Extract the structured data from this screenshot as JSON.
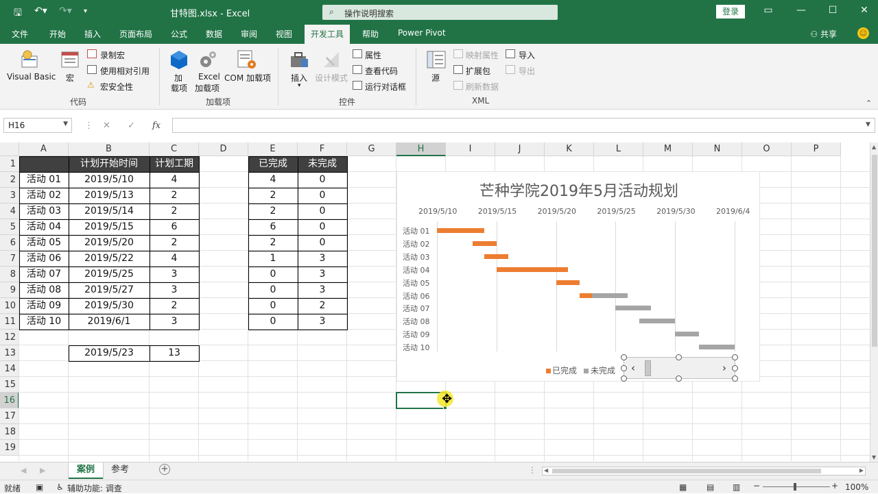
{
  "window": {
    "title": "甘特图.xlsx  -  Excel",
    "search_placeholder": "操作说明搜索",
    "login": "登录"
  },
  "tabs": [
    "文件",
    "开始",
    "插入",
    "页面布局",
    "公式",
    "数据",
    "审阅",
    "视图",
    "开发工具",
    "帮助",
    "Power Pivot"
  ],
  "active_tab": "开发工具",
  "share": "共享",
  "ribbon": {
    "code": {
      "group": "代码",
      "visual_basic": "Visual Basic",
      "macro": "宏",
      "record_macro": "录制宏",
      "relative_ref": "使用相对引用",
      "macro_security": "宏安全性"
    },
    "addins": {
      "group": "加载项",
      "addin_1": "加",
      "addin_2": "载项",
      "excel_addin_1": "Excel",
      "excel_addin_2": "加载项",
      "com_addin": "COM 加载项"
    },
    "controls": {
      "group": "控件",
      "insert": "插入",
      "design_mode": "设计模式",
      "properties": "属性",
      "view_code": "查看代码",
      "run_dialog": "运行对话框"
    },
    "xml": {
      "group": "XML",
      "source": "源",
      "map_properties": "映射属性",
      "expansion_packs": "扩展包",
      "refresh_data": "刷新数据",
      "import": "导入",
      "export": "导出"
    }
  },
  "formula_bar": {
    "name_box": "H16",
    "fx": "fx",
    "formula": ""
  },
  "columns": [
    "A",
    "B",
    "C",
    "D",
    "E",
    "F",
    "G",
    "H",
    "I",
    "J",
    "K",
    "L",
    "M",
    "N",
    "O",
    "P"
  ],
  "rows": [
    "1",
    "2",
    "3",
    "4",
    "5",
    "6",
    "7",
    "8",
    "9",
    "10",
    "11",
    "12",
    "13",
    "14",
    "15",
    "16",
    "17",
    "18",
    "19"
  ],
  "table1": {
    "headers": [
      "",
      "计划开始时间",
      "计划工期"
    ],
    "rows": [
      [
        "活动 01",
        "2019/5/10",
        "4"
      ],
      [
        "活动 02",
        "2019/5/13",
        "2"
      ],
      [
        "活动 03",
        "2019/5/14",
        "2"
      ],
      [
        "活动 04",
        "2019/5/15",
        "6"
      ],
      [
        "活动 05",
        "2019/5/20",
        "2"
      ],
      [
        "活动 06",
        "2019/5/22",
        "4"
      ],
      [
        "活动 07",
        "2019/5/25",
        "3"
      ],
      [
        "活动 08",
        "2019/5/27",
        "3"
      ],
      [
        "活动 09",
        "2019/5/30",
        "2"
      ],
      [
        "活动 10",
        "2019/6/1",
        "3"
      ]
    ]
  },
  "table2": {
    "headers": [
      "已完成",
      "未完成"
    ],
    "rows": [
      [
        "4",
        "0"
      ],
      [
        "2",
        "0"
      ],
      [
        "2",
        "0"
      ],
      [
        "6",
        "0"
      ],
      [
        "2",
        "0"
      ],
      [
        "1",
        "3"
      ],
      [
        "0",
        "3"
      ],
      [
        "0",
        "3"
      ],
      [
        "0",
        "2"
      ],
      [
        "0",
        "3"
      ]
    ]
  },
  "current_date": {
    "date": "2019/5/23",
    "value": "13"
  },
  "chart_data": {
    "type": "bar",
    "title": "芒种学院2019年5月活动规划",
    "x_tick_labels": [
      "2019/5/10",
      "2019/5/15",
      "2019/5/20",
      "2019/5/25",
      "2019/5/30",
      "2019/6/4"
    ],
    "xlim": [
      "2019/5/10",
      "2019/6/4"
    ],
    "categories": [
      "活动 01",
      "活动 02",
      "活动 03",
      "活动 04",
      "活动 05",
      "活动 06",
      "活动 07",
      "活动 08",
      "活动 09",
      "活动 10"
    ],
    "start": [
      "2019/5/10",
      "2019/5/13",
      "2019/5/14",
      "2019/5/15",
      "2019/5/20",
      "2019/5/22",
      "2019/5/25",
      "2019/5/27",
      "2019/5/30",
      "2019/6/1"
    ],
    "series": [
      {
        "name": "已完成",
        "values": [
          4,
          2,
          2,
          6,
          2,
          1,
          0,
          0,
          0,
          0
        ],
        "color": "#ed7d31"
      },
      {
        "name": "未完成",
        "values": [
          0,
          0,
          0,
          0,
          0,
          3,
          3,
          3,
          2,
          3
        ],
        "color": "#a5a5a5"
      }
    ],
    "orientation": "horizontal-stacked",
    "grid": true,
    "legend": "bottom-right"
  },
  "sheets": [
    "案例",
    "参考"
  ],
  "active_sheet": "案例",
  "status": {
    "mode": "就绪",
    "accessibility": "辅助功能: 调查",
    "zoom": "100%"
  },
  "colors": {
    "excel_green": "#217346",
    "header_dark": "#404040"
  }
}
